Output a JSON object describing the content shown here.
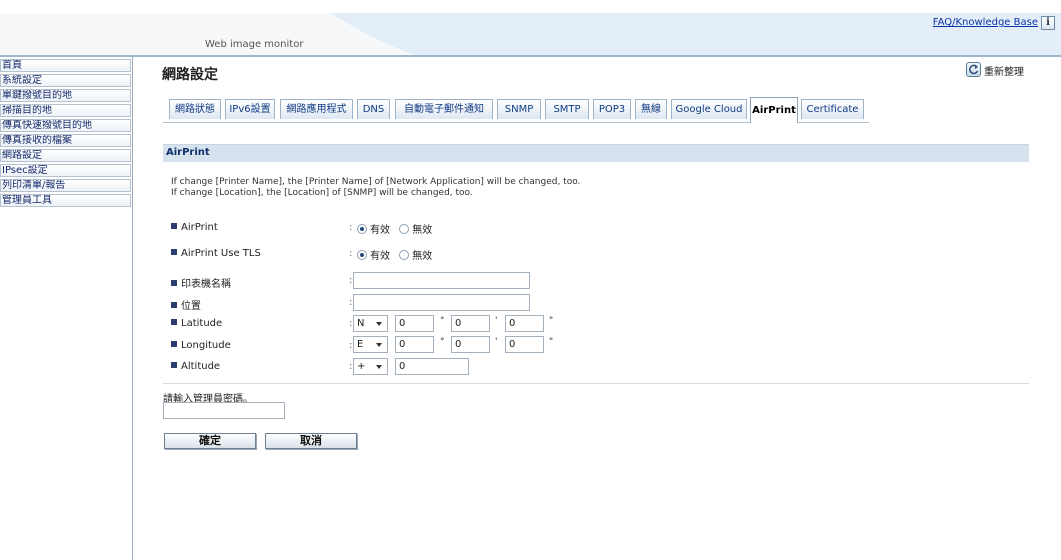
{
  "header": {
    "title": "Web image monitor",
    "faq_link": "FAQ/Knowledge Base",
    "info_icon": "i"
  },
  "sidebar": {
    "items": [
      {
        "label": "首頁"
      },
      {
        "label": "系統設定"
      },
      {
        "label": "單鍵撥號目的地"
      },
      {
        "label": "掃描目的地"
      },
      {
        "label": "傳真快速撥號目的地"
      },
      {
        "label": "傳真接收的檔案"
      },
      {
        "label": "網路設定"
      },
      {
        "label": "IPsec設定"
      },
      {
        "label": "列印清單/報告"
      },
      {
        "label": "管理員工具"
      }
    ]
  },
  "page": {
    "title": "網路設定",
    "refresh_label": "重新整理"
  },
  "tabs": [
    {
      "label": "網路狀態"
    },
    {
      "label": "IPv6設置"
    },
    {
      "label": "網路應用程式"
    },
    {
      "label": "DNS"
    },
    {
      "label": "自動電子郵件通知"
    },
    {
      "label": "SNMP"
    },
    {
      "label": "SMTP"
    },
    {
      "label": "POP3"
    },
    {
      "label": "無線"
    },
    {
      "label": "Google Cloud"
    },
    {
      "label": "AirPrint",
      "active": true
    },
    {
      "label": "Certificate"
    }
  ],
  "section": {
    "title": "AirPrint",
    "note_1": "If change [Printer Name], the [Printer Name] of [Network Application] will be changed, too.",
    "note_2": "If change [Location], the [Location] of [SNMP] will be changed, too."
  },
  "form": {
    "colon": ":",
    "airprint": {
      "label": "AirPrint",
      "option_on": "有效",
      "option_off": "無效",
      "selected": "有效"
    },
    "airprint_tls": {
      "label": "AirPrint Use TLS",
      "option_on": "有效",
      "option_off": "無效",
      "selected": "有效"
    },
    "printer_name": {
      "label": "印表機名稱",
      "value": ""
    },
    "location": {
      "label": "位置",
      "value": ""
    },
    "latitude": {
      "label": "Latitude",
      "direction": "N",
      "deg": "0",
      "min": "0",
      "sec": "0"
    },
    "longitude": {
      "label": "Longitude",
      "direction": "E",
      "deg": "0",
      "min": "0",
      "sec": "0"
    },
    "altitude": {
      "label": "Altitude",
      "sign": "+",
      "value": "0"
    },
    "units": {
      "deg": "°",
      "min": "'",
      "sec": "\""
    }
  },
  "password": {
    "label": "請輸入管理員密碼。",
    "value": ""
  },
  "buttons": {
    "ok": "確定",
    "cancel": "取消"
  },
  "colors": {
    "section_bar": "#d6e3ef",
    "link": "#0a33a6",
    "sidebar_text": "#12286a"
  }
}
